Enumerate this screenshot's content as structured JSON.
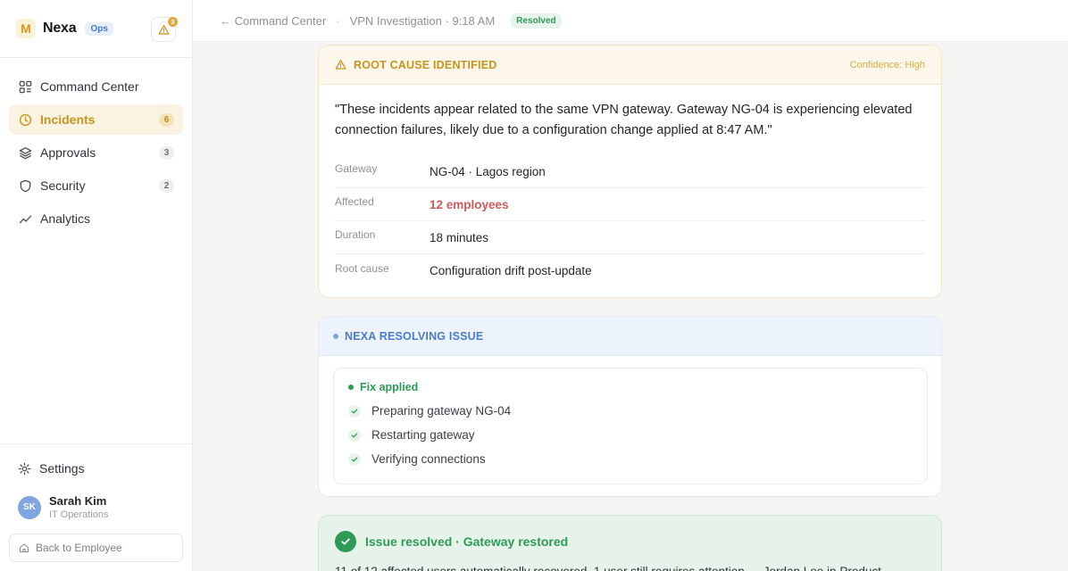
{
  "brand": {
    "logo_letter": "M",
    "name": "Nexa",
    "badge": "Ops",
    "alerts_count": "3"
  },
  "nav": {
    "items": [
      {
        "label": "Command Center",
        "icon": "grid-icon",
        "count": ""
      },
      {
        "label": "Incidents",
        "icon": "clock-icon",
        "count": "6",
        "active": true
      },
      {
        "label": "Approvals",
        "icon": "layers-icon",
        "count": "3"
      },
      {
        "label": "Security",
        "icon": "shield-icon",
        "count": "2"
      },
      {
        "label": "Analytics",
        "icon": "trend-icon",
        "count": ""
      }
    ]
  },
  "footer": {
    "settings_label": "Settings",
    "user": {
      "initials": "SK",
      "name": "Sarah Kim",
      "role": "IT Operations"
    },
    "back_label": "Back to Employee"
  },
  "header": {
    "back_crumb": "← Command Center",
    "title": "VPN Investigation",
    "time": "9:18 AM",
    "status": "Resolved"
  },
  "root_cause": {
    "title": "ROOT CAUSE IDENTIFIED",
    "confidence": "Confidence: High",
    "quote": "\"These incidents appear related to the same VPN gateway. Gateway NG-04 is experiencing elevated connection failures, likely due to a configuration change applied at 8:47 AM.\"",
    "rows": [
      {
        "label": "Gateway",
        "value": "NG-04 · Lagos region"
      },
      {
        "label": "Affected",
        "value": "12 employees"
      },
      {
        "label": "Duration",
        "value": "18 minutes"
      },
      {
        "label": "Root cause",
        "value": "Configuration drift post-update"
      }
    ]
  },
  "resolving": {
    "title": "NEXA RESOLVING ISSUE",
    "fix_title": "Fix applied",
    "steps": [
      "Preparing gateway NG-04",
      "Restarting gateway",
      "Verifying connections"
    ]
  },
  "resolved": {
    "title": "Issue resolved · Gateway restored",
    "text": "11 of 12 affected users automatically recovered. 1 user still requires attention — Jordan Lee in Product."
  },
  "colors": {
    "accent": "#c4951f",
    "success": "#2f9a56",
    "info": "#4a7cc8",
    "alert": "#d0595b"
  }
}
